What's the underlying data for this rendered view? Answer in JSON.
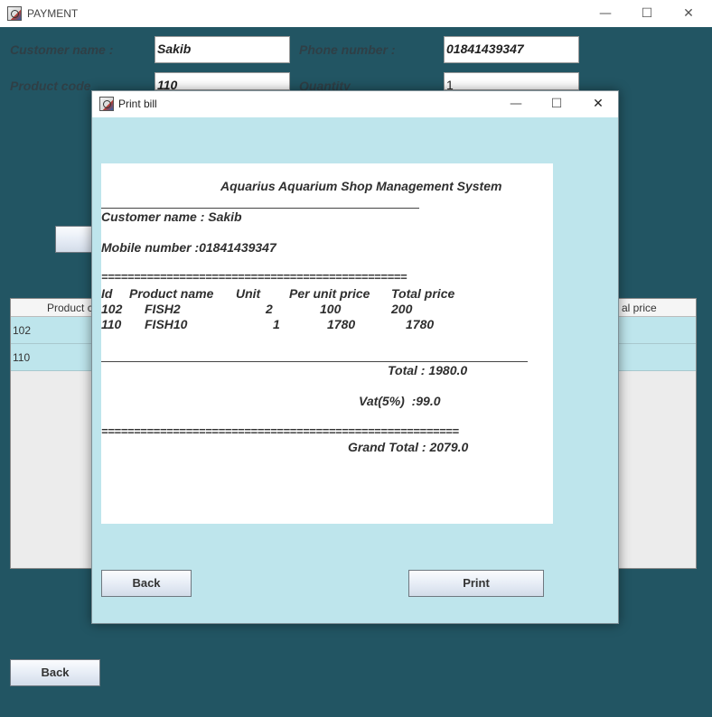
{
  "main_window": {
    "title": "PAYMENT",
    "controls": {
      "minimize": "—",
      "maximize": "☐",
      "close": "✕"
    }
  },
  "form": {
    "customer_name_label": "Customer name :",
    "customer_name_value": "Sakib",
    "phone_label": "Phone number :",
    "phone_value": "01841439347",
    "product_code_label": "Product code",
    "product_code_value": "110",
    "quantity_label": "Quantity",
    "quantity_value": "1"
  },
  "table": {
    "headers": [
      "Product c",
      "al price"
    ],
    "rows": [
      {
        "code": "102"
      },
      {
        "code": "110"
      }
    ]
  },
  "main_back_label": "Back",
  "dialog": {
    "title": "Print bill",
    "controls": {
      "minimize": "—",
      "maximize": "☐",
      "close": "✕"
    },
    "receipt": {
      "shop_title": "Aquarius Aquarium Shop Management System",
      "customer_line": "Customer name : Sakib",
      "mobile_line": "Mobile number :01841439347",
      "separator_1": "===============================================",
      "col_id": "Id",
      "col_product": "Product name",
      "col_unit": "Unit",
      "col_per_unit": "Per unit price",
      "col_total": "Total price",
      "items": [
        {
          "id": "102",
          "name": "FISH2",
          "unit": "2",
          "price": "100",
          "total": "200"
        },
        {
          "id": "110",
          "name": "FISH10",
          "unit": "1",
          "price": "1780",
          "total": "1780"
        }
      ],
      "total_line": "Total : 1980.0",
      "vat_line": "Vat(5%)  :99.0",
      "separator_2": "=======================================================",
      "grand_total_line": "Grand Total : 2079.0"
    },
    "back_label": "Back",
    "print_label": "Print"
  }
}
